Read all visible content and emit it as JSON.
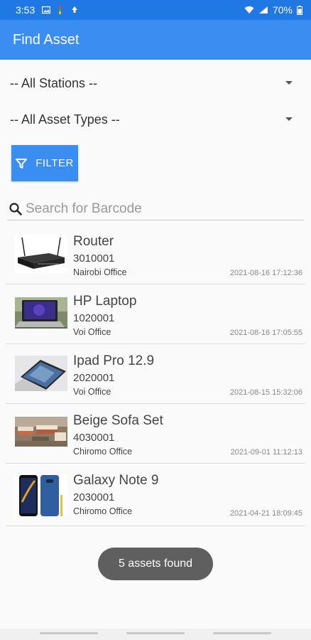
{
  "status_bar": {
    "time": "3:53",
    "battery": "70%"
  },
  "app_bar": {
    "title": "Find Asset"
  },
  "filters": {
    "station": "-- All Stations --",
    "asset_type": "-- All Asset Types --",
    "filter_label": "FILTER"
  },
  "search": {
    "placeholder": "Search for Barcode"
  },
  "assets": [
    {
      "name": "Router",
      "code": "3010001",
      "office": "Nairobi Office",
      "date": "2021-08-16 17:12:36"
    },
    {
      "name": "HP Laptop",
      "code": "1020001",
      "office": "Voi Office",
      "date": "2021-08-16 17:05:55"
    },
    {
      "name": "Ipad Pro 12.9",
      "code": "2020001",
      "office": "Voi Office",
      "date": "2021-08-15 15:32:06"
    },
    {
      "name": "Beige Sofa Set",
      "code": "4030001",
      "office": "Chiromo Office",
      "date": "2021-09-01 11:12:13"
    },
    {
      "name": "Galaxy Note 9",
      "code": "2030001",
      "office": "Chiromo Office",
      "date": "2021-04-21 18:09:45"
    }
  ],
  "toast": {
    "text": "5 assets found"
  },
  "colors": {
    "status_bar": "#1f78e4",
    "primary": "#3a8ef1",
    "toast": "#5f5f5f"
  }
}
